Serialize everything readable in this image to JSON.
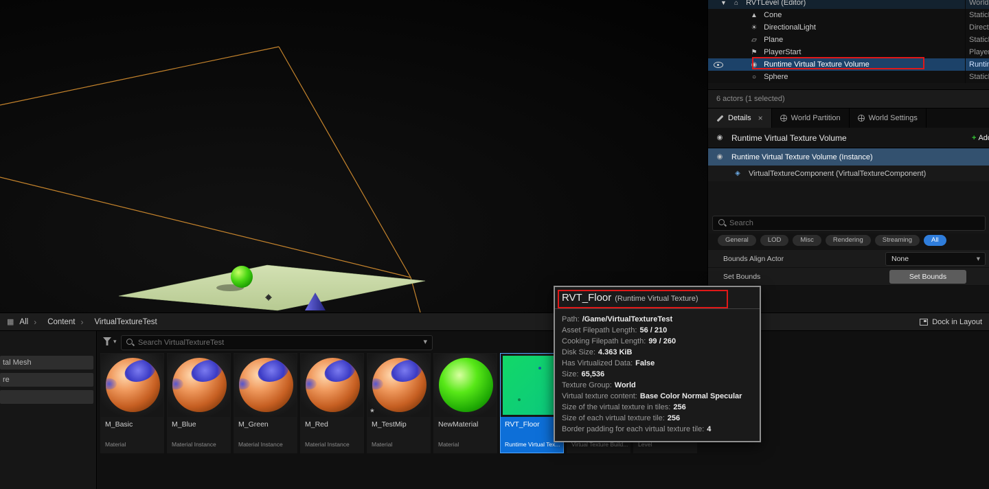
{
  "colors": {
    "accent_blue": "#2f7ddb",
    "selection_blue": "#1c4269",
    "tile_selected_blue": "#0d6fd8",
    "annotation_red": "#e01818",
    "wireframe_orange": "#cf8a2e"
  },
  "icons": [
    "eye-icon",
    "expand-caret-icon",
    "level-icon",
    "cone-icon",
    "directional-light-icon",
    "plane-icon",
    "player-start-icon",
    "rvt-volume-icon",
    "sphere-icon",
    "pencil-icon",
    "close-icon",
    "globe-icon",
    "add-plus-icon",
    "component-icon",
    "search-icon",
    "chevron-down-icon",
    "filter-funnel-icon",
    "breadcrumb-grid-icon",
    "dock-icon",
    "unsaved-asterisk-icon"
  ],
  "outliner": {
    "rows": [
      {
        "label": "RVTLevel (Editor)",
        "type": "World",
        "icon": "level-icon"
      },
      {
        "label": "Cone",
        "type": "StaticM",
        "icon": "cone-icon"
      },
      {
        "label": "DirectionalLight",
        "type": "Direct",
        "icon": "directional-light-icon"
      },
      {
        "label": "Plane",
        "type": "StaticM",
        "icon": "plane-icon"
      },
      {
        "label": "PlayerStart",
        "type": "Player",
        "icon": "player-start-icon"
      },
      {
        "label": "Runtime Virtual Texture Volume",
        "type": "Runtim",
        "icon": "rvt-volume-icon"
      },
      {
        "label": "Sphere",
        "type": "StaticM",
        "icon": "sphere-icon"
      }
    ],
    "status": "6 actors (1 selected)"
  },
  "details": {
    "tabs": [
      {
        "label": "Details"
      },
      {
        "label": "World Partition"
      },
      {
        "label": "World Settings"
      }
    ],
    "close_label": "×",
    "actor_title": "Runtime Virtual Texture Volume",
    "add_button": "Add",
    "instance_row": "Runtime Virtual Texture Volume (Instance)",
    "component_row": "VirtualTextureComponent (VirtualTextureComponent)",
    "search_placeholder": "Search",
    "filters": [
      {
        "label": "General"
      },
      {
        "label": "LOD"
      },
      {
        "label": "Misc"
      },
      {
        "label": "Rendering"
      },
      {
        "label": "Streaming"
      },
      {
        "label": "All"
      }
    ],
    "active_filter": "All",
    "properties": {
      "bounds_align_actor_label": "Bounds Align Actor",
      "bounds_align_actor_value": "None",
      "set_bounds_label": "Set Bounds",
      "set_bounds_button": "Set Bounds"
    }
  },
  "content_browser": {
    "breadcrumb": [
      {
        "label": "All"
      },
      {
        "label": "Content"
      },
      {
        "label": "VirtualTextureTest"
      }
    ],
    "dock_in_layout": "Dock in Layout",
    "search_placeholder": "Search VirtualTextureTest",
    "sidebar_items": [
      {
        "label": "tal Mesh"
      },
      {
        "label": "re"
      },
      {
        "label": ""
      }
    ],
    "assets": [
      {
        "name": "M_Basic",
        "type": "Material"
      },
      {
        "name": "M_Blue",
        "type": "Material Instance"
      },
      {
        "name": "M_Green",
        "type": "Material Instance"
      },
      {
        "name": "M_Red",
        "type": "Material Instance"
      },
      {
        "name": "M_TestMip",
        "type": "Material"
      },
      {
        "name": "NewMaterial",
        "type": "Material"
      },
      {
        "name": "RVT_Floor",
        "type": "Runtime Virtual Tex...",
        "selected": true
      },
      {
        "name": "",
        "type": "Virtual Texture Build..."
      },
      {
        "name": "",
        "type": "Level"
      }
    ]
  },
  "tooltip": {
    "title": "RVT_Floor",
    "subtitle": "(Runtime Virtual Texture)",
    "rows": [
      {
        "label": "Path:",
        "value": "/Game/VirtualTextureTest"
      },
      {
        "label": "Asset Filepath Length:",
        "value": "56 / 210"
      },
      {
        "label": "Cooking Filepath Length:",
        "value": "99 / 260"
      },
      {
        "label": "Disk Size:",
        "value": "4.363 KiB"
      },
      {
        "label": "Has Virtualized Data:",
        "value": "False"
      },
      {
        "label": "Size:",
        "value": "65,536"
      },
      {
        "label": "Texture Group:",
        "value": "World"
      },
      {
        "label": "Virtual texture content:",
        "value": "Base Color Normal Specular"
      },
      {
        "label": "Size of the virtual texture in tiles:",
        "value": "256"
      },
      {
        "label": "Size of each virtual texture tile:",
        "value": "256"
      },
      {
        "label": "Border padding for each virtual texture tile:",
        "value": "4"
      }
    ]
  }
}
